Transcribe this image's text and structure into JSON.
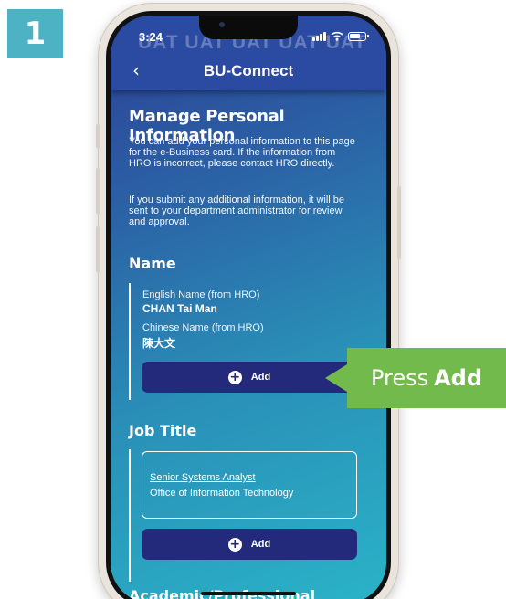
{
  "step_number": "1",
  "status_bar": {
    "time": "3:24",
    "watermark": "UAT UAT UAT UAT UAT"
  },
  "app_bar": {
    "title": "BU-Connect",
    "back_icon": "chevron-left-icon"
  },
  "page": {
    "heading": "Manage Personal Information",
    "paragraph1": "You can add your personal information to this page for the e-Business card. If the information from HRO is incorrect, please contact HRO directly.",
    "paragraph2": "If you submit any additional information, it will be sent to your department administrator for review and approval."
  },
  "name_section": {
    "heading": "Name",
    "english_label": "English Name (from HRO)",
    "english_value": "CHAN Tai Man",
    "chinese_label": "Chinese Name (from HRO)",
    "chinese_value": "陳大文",
    "add_label": "Add"
  },
  "job_section": {
    "heading": "Job Title",
    "title": "Senior Systems Analyst",
    "department": "Office of Information Technology",
    "add_label": "Add"
  },
  "academic_section": {
    "heading": "Academic/Professional"
  },
  "callout": {
    "text_prefix": "Press",
    "text_bold": "Add",
    "color": "#72ba4c"
  },
  "colors": {
    "step_badge": "#4db3c4",
    "app_bar": "#2b4aa1",
    "button": "#232a7c"
  }
}
